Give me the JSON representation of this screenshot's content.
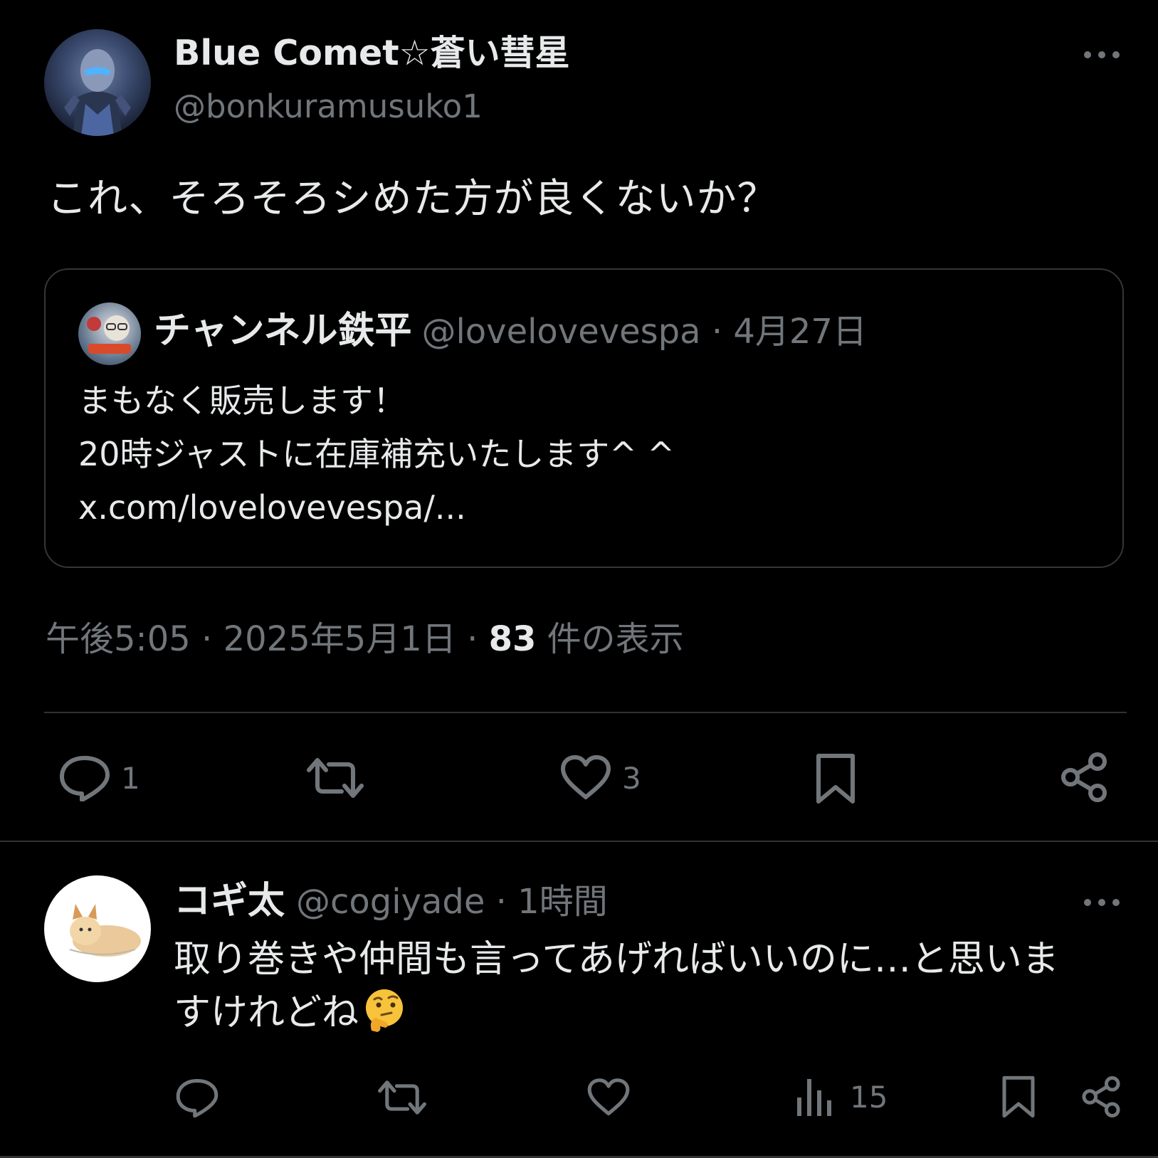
{
  "theme": {
    "background": "#000000",
    "text_primary": "#e7e9ea",
    "text_secondary": "#71767b",
    "border": "#2f3336"
  },
  "post": {
    "author": {
      "display_name": "Blue Comet☆蒼い彗星",
      "handle": "@bonkuramusuko1"
    },
    "text": "これ、そろそろシめた方が良くないか？",
    "quote": {
      "author_name": "チャンネル鉄平",
      "meta": "@lovelovevespa · 4月27日",
      "lines": [
        "まもなく販売します！",
        "20時ジャストに在庫補充いたします^ ^",
        "x.com/lovelovevespa/..."
      ]
    },
    "meta": {
      "time": "午後5:05",
      "separator": " · ",
      "date": "2025年5月1日",
      "views_count": "83",
      "views_label": " 件の表示"
    },
    "actions": {
      "reply_icon": "reply-icon",
      "reply_count": "1",
      "repost_icon": "repost-icon",
      "like_icon": "heart-icon",
      "like_count": "3",
      "bookmark_icon": "bookmark-icon",
      "share_icon": "share-icon"
    }
  },
  "reply": {
    "author_name": "コギ太",
    "meta": "@cogiyade · 1時間",
    "lines": [
      "取り巻きや仲間も言ってあげればいいのに…と思いま",
      "すけれどね"
    ],
    "emoji": "thinking-face",
    "actions": {
      "views_count": "15"
    }
  }
}
